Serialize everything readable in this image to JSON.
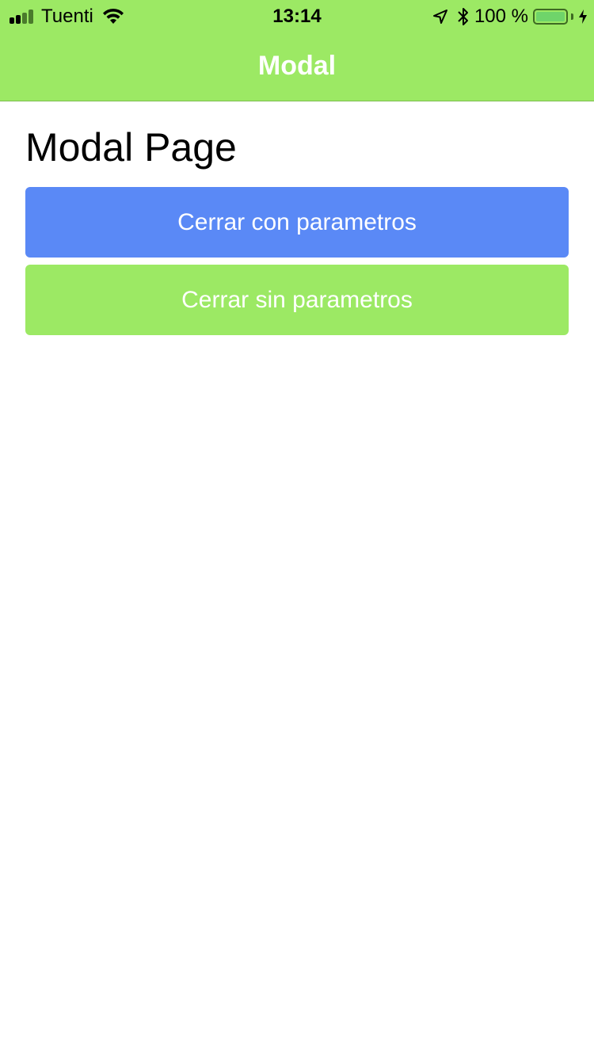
{
  "status_bar": {
    "carrier": "Tuenti",
    "time": "13:14",
    "battery_percent": "100 %",
    "battery_level": 1.0,
    "signal_bars_total": 4,
    "signal_bars_active": 2,
    "icons": [
      "signal-icon",
      "wifi-icon",
      "location-icon",
      "bluetooth-icon",
      "battery-icon",
      "charging-icon"
    ]
  },
  "header": {
    "title": "Modal"
  },
  "main": {
    "heading": "Modal Page",
    "buttons": [
      {
        "label": "Cerrar con parametros",
        "color": "#5a89f6"
      },
      {
        "label": "Cerrar sin parametros",
        "color": "#9ce964"
      }
    ]
  },
  "colors": {
    "header_background": "#9ce964",
    "primary": "#5a89f6",
    "secondary": "#9ce964",
    "page_background": "#ffffff"
  }
}
